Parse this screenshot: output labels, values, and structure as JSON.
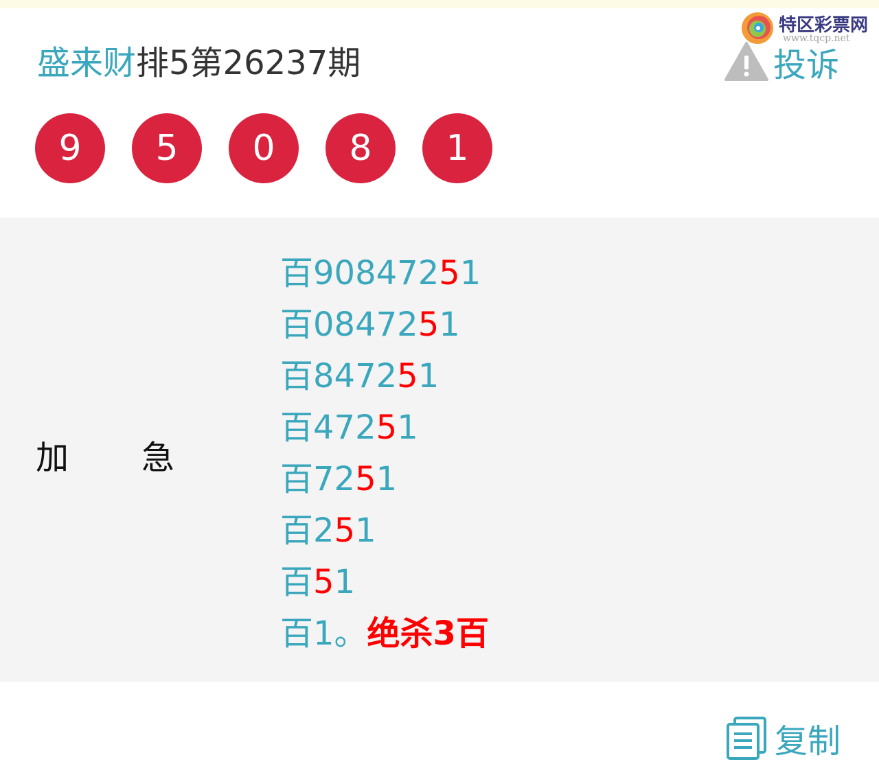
{
  "logo": {
    "name": "特区彩票网",
    "url": "www.tqcp.net"
  },
  "header": {
    "author": "盛来财",
    "title_rest": "排5第26237期",
    "complain_label": "投诉"
  },
  "balls": [
    "9",
    "5",
    "0",
    "8",
    "1"
  ],
  "labels": [
    "加",
    "急"
  ],
  "predictions": [
    {
      "prefix": "百",
      "main": "908472",
      "highlight": "5",
      "tail": "1"
    },
    {
      "prefix": "百",
      "main": "08472",
      "highlight": "5",
      "tail": "1"
    },
    {
      "prefix": "百",
      "main": "8472",
      "highlight": "5",
      "tail": "1"
    },
    {
      "prefix": "百",
      "main": "472",
      "highlight": "5",
      "tail": "1"
    },
    {
      "prefix": "百",
      "main": "72",
      "highlight": "5",
      "tail": "1"
    },
    {
      "prefix": "百",
      "main": "2",
      "highlight": "5",
      "tail": "1"
    },
    {
      "prefix": "百",
      "main": "",
      "highlight": "5",
      "tail": "1"
    }
  ],
  "final_line": {
    "prefix": "百1。",
    "kill": "绝杀3百"
  },
  "copy_label": "复制",
  "colors": {
    "accent": "#3aa7bd",
    "ball": "#d9233f",
    "highlight": "#ff0000",
    "panel": "#f4f4f4"
  }
}
